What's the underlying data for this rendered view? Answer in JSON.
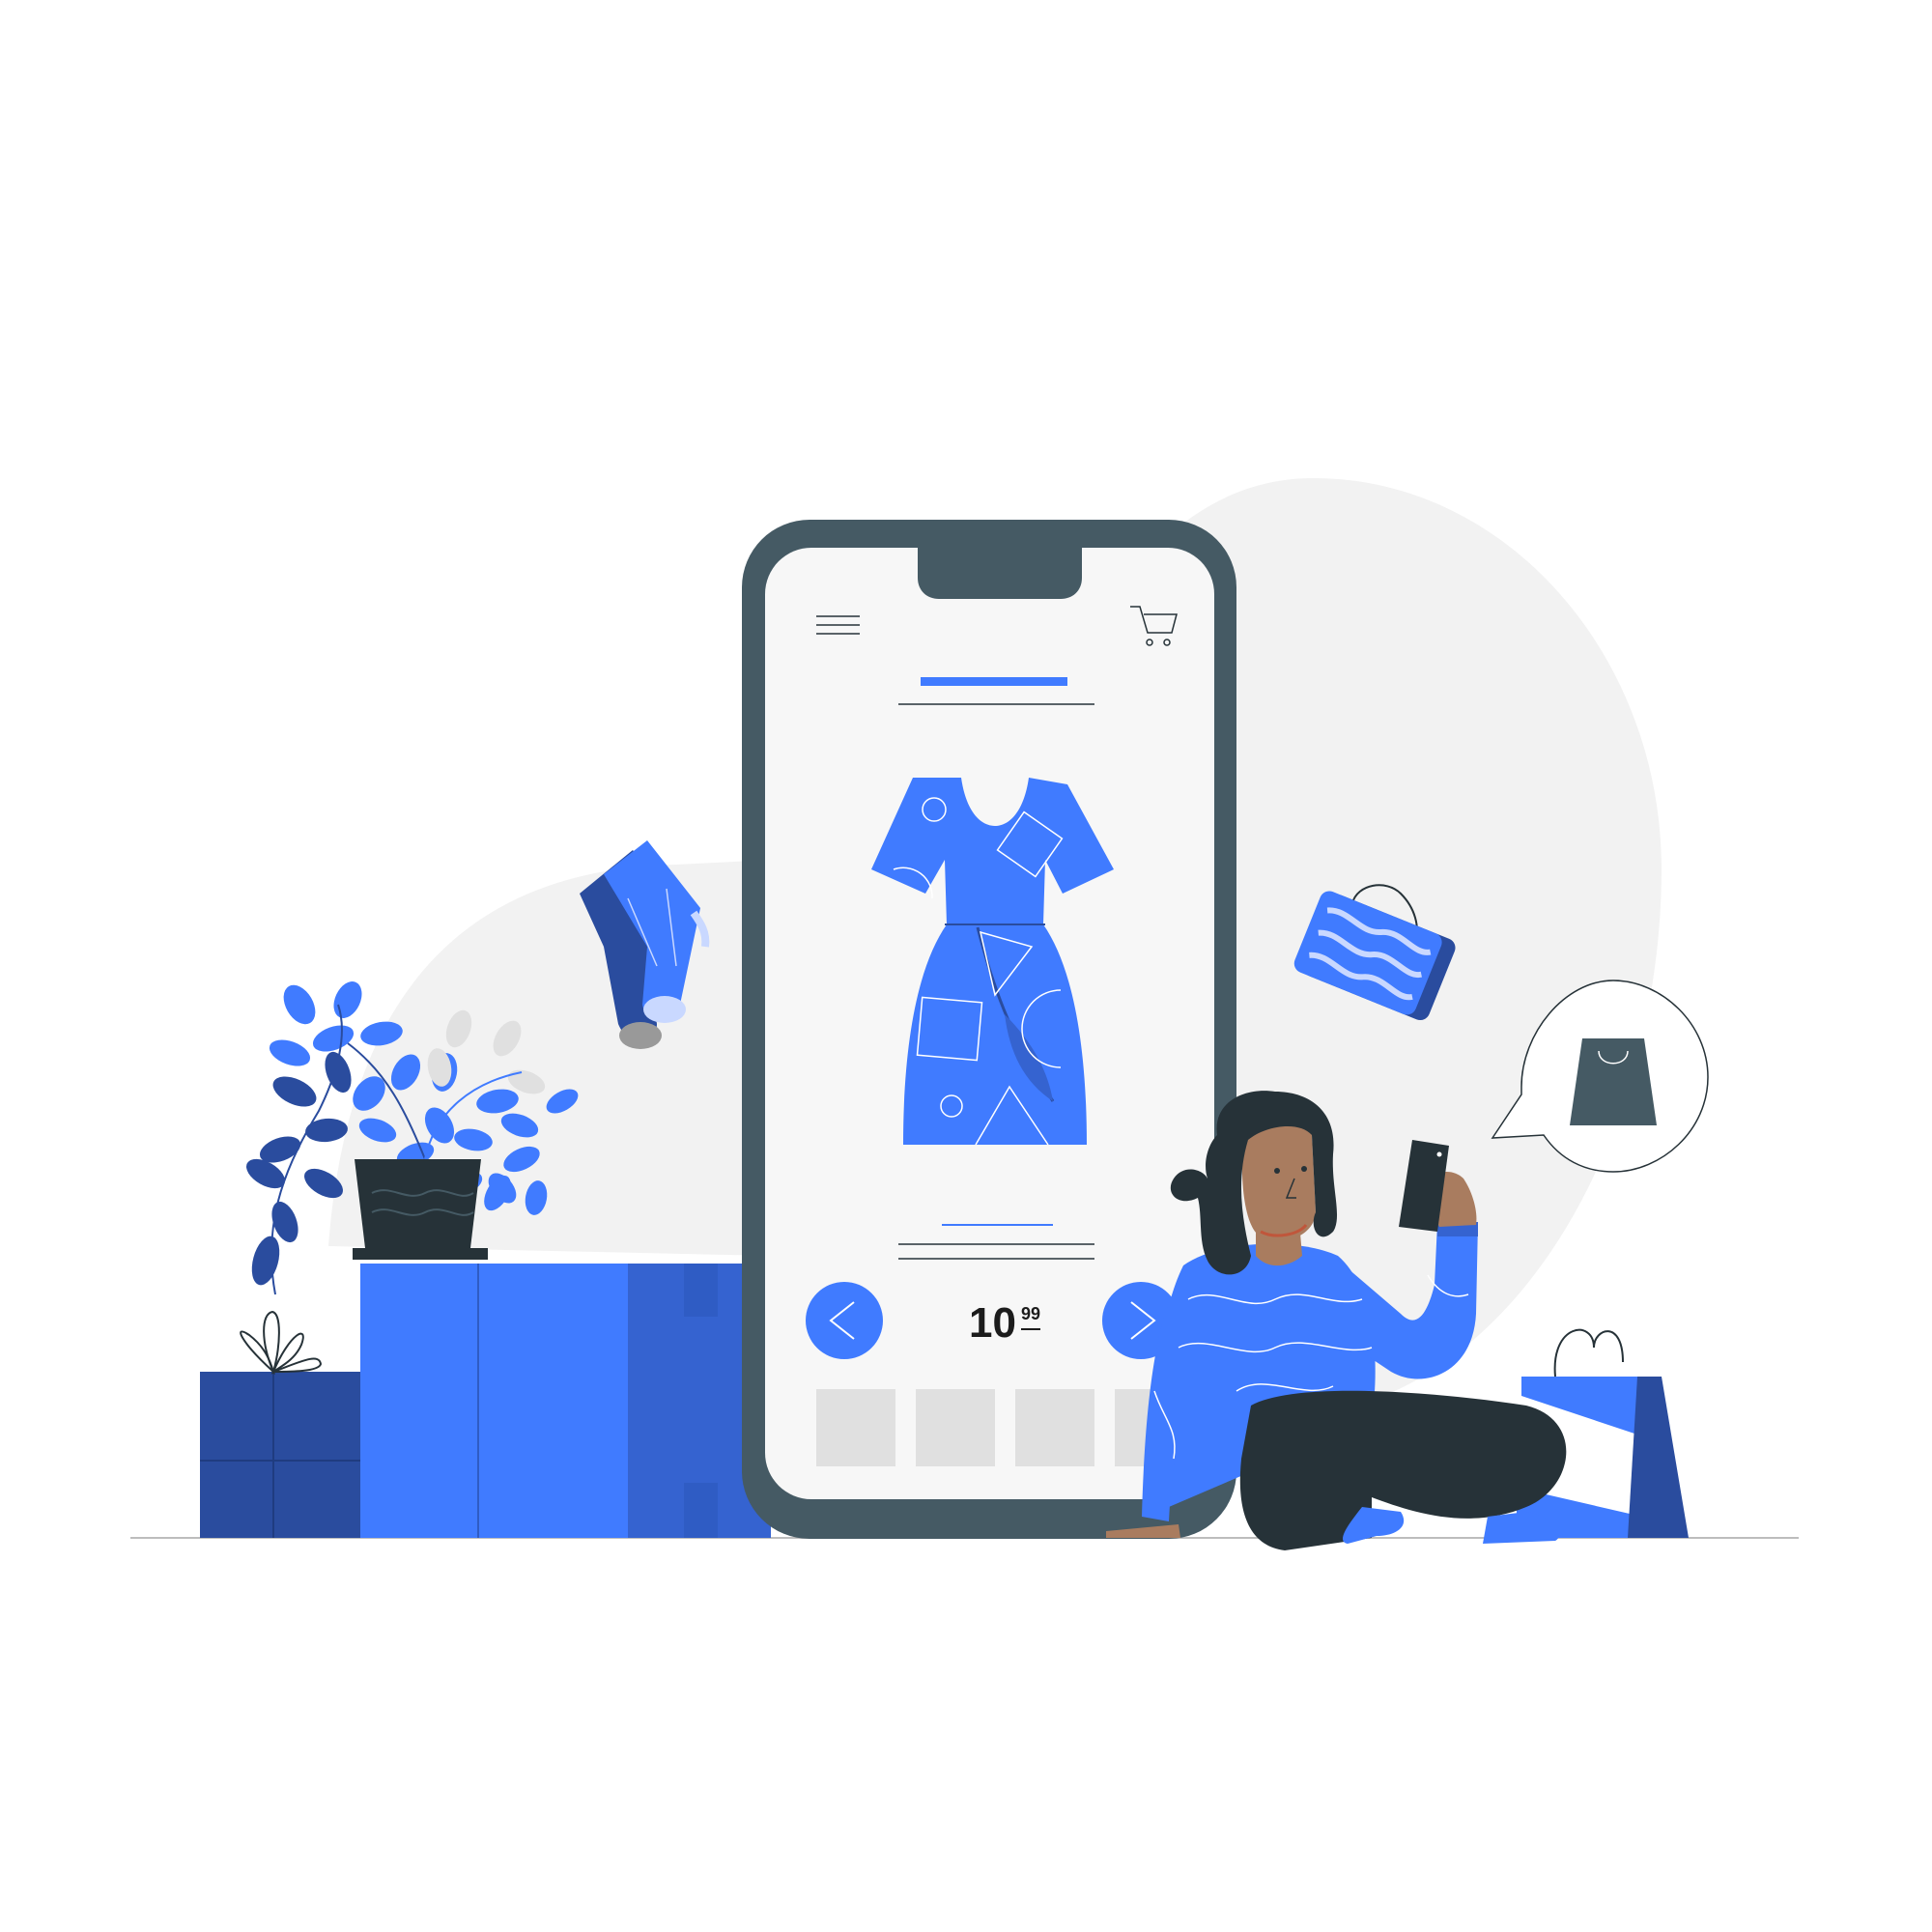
{
  "product": {
    "price_whole": "10",
    "price_cents": "99"
  },
  "icons": {
    "menu": "hamburger-menu-icon",
    "cart": "shopping-cart-icon",
    "prev": "chevron-left-icon",
    "next": "chevron-right-icon",
    "bubble": "shopping-bag-icon"
  },
  "colors": {
    "accent": "#407bff",
    "accent_dark": "#2a4c9e",
    "accent_mid": "#3563d0",
    "phone_frame": "#455a64",
    "screen": "#f7f7f7",
    "blob": "#f2f2f2",
    "thumb": "#e0e0e0",
    "dark": "#263238",
    "skin": "#a97c5f"
  },
  "thumbnails_count": 4
}
